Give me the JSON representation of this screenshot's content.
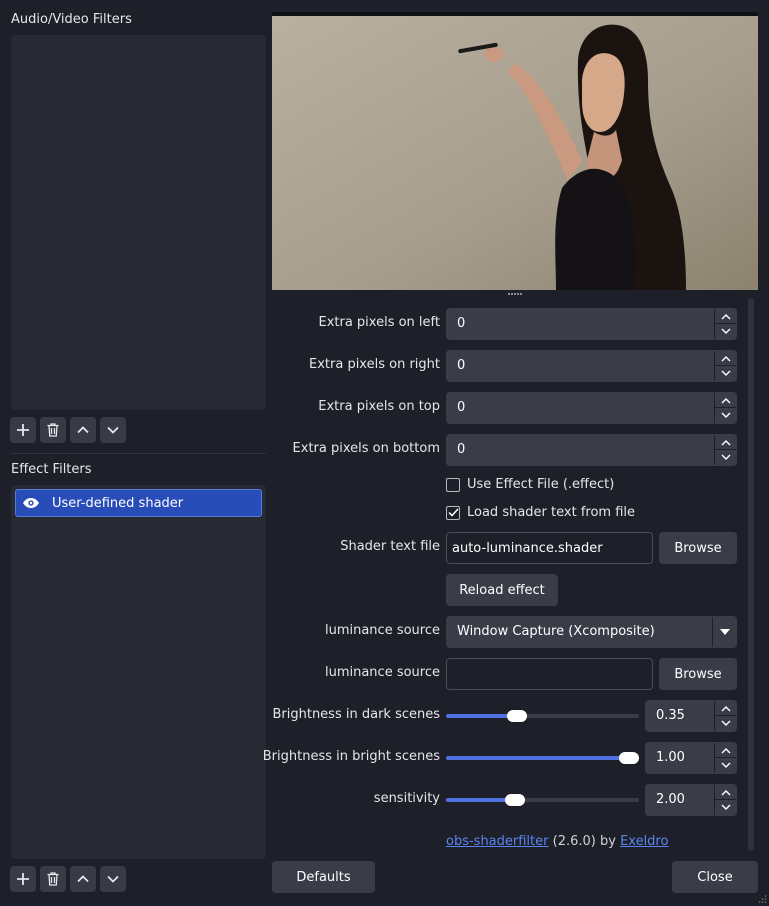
{
  "left_panel": {
    "audio_video_title": "Audio/Video Filters",
    "effect_title": "Effect Filters",
    "effect_items": [
      {
        "label": "User-defined shader",
        "icon": "eye-icon",
        "selected": true
      }
    ],
    "toolbar_icons": [
      "plus-icon",
      "trash-icon",
      "chevron-up-icon",
      "chevron-down-icon"
    ]
  },
  "preview": {
    "description_icon": "preview-image"
  },
  "properties": {
    "extra_left": {
      "label": "Extra pixels on left",
      "value": "0"
    },
    "extra_right": {
      "label": "Extra pixels on right",
      "value": "0"
    },
    "extra_top": {
      "label": "Extra pixels on top",
      "value": "0"
    },
    "extra_bottom": {
      "label": "Extra pixels on bottom",
      "value": "0"
    },
    "use_effect_file": {
      "label": "Use Effect File (.effect)",
      "checked": false
    },
    "load_shader_text": {
      "label": "Load shader text from file",
      "checked": true
    },
    "shader_text_file": {
      "label": "Shader text file",
      "value": "auto-luminance.shader",
      "button": "Browse"
    },
    "reload_effect": "Reload effect",
    "luminance_source_combo": {
      "label": "luminance source",
      "value": "Window Capture (Xcomposite)"
    },
    "luminance_source_file": {
      "label": "luminance source",
      "value": "",
      "button": "Browse"
    },
    "brightness_dark": {
      "label": "Brightness in dark scenes",
      "value": "0.35",
      "level": 0.35
    },
    "brightness_bright": {
      "label": "Brightness in bright scenes",
      "value": "1.00",
      "level": 1.0
    },
    "sensitivity": {
      "label": "sensitivity",
      "value": "2.00",
      "level": 0.34
    },
    "footer": {
      "link": "obs-shaderfilter",
      "version": " (2.6.0) by ",
      "author": "Exeldro"
    }
  },
  "buttons": {
    "defaults": "Defaults",
    "close": "Close"
  },
  "colors": {
    "background": "#1e2029",
    "accent": "#284cb8",
    "slider_fill": "#4f72e0",
    "link": "#5b84f0"
  }
}
